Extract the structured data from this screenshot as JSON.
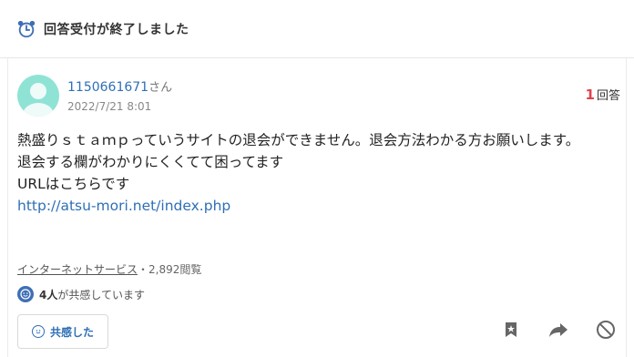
{
  "status": {
    "title": "回答受付が終了しました",
    "icon": "alarm-clock-icon"
  },
  "question": {
    "user_id": "1150661671",
    "user_suffix": "さん",
    "date": "2022/7/21 8:01",
    "answer_count": "1",
    "answer_label": "回答",
    "lines": [
      "熱盛りｓｔａｍｐっていうサイトの退会ができません。退会方法わかる方お願いします。",
      "退会する欄がわかりにくくてて困ってます",
      "URLはこちらです"
    ],
    "link": "http://atsu-mori.net/index.php"
  },
  "meta": {
    "category": "インターネットサービス",
    "separator": "・",
    "views": "2,892閲覧"
  },
  "empathy": {
    "count": "4人",
    "text": "が共感しています",
    "button_label": "共感した"
  },
  "actions": [
    "bookmark-icon",
    "share-icon",
    "block-icon"
  ],
  "colors": {
    "link": "#2f6fb5",
    "accent_red": "#e0424d",
    "avatar": "#8fe3d5"
  }
}
